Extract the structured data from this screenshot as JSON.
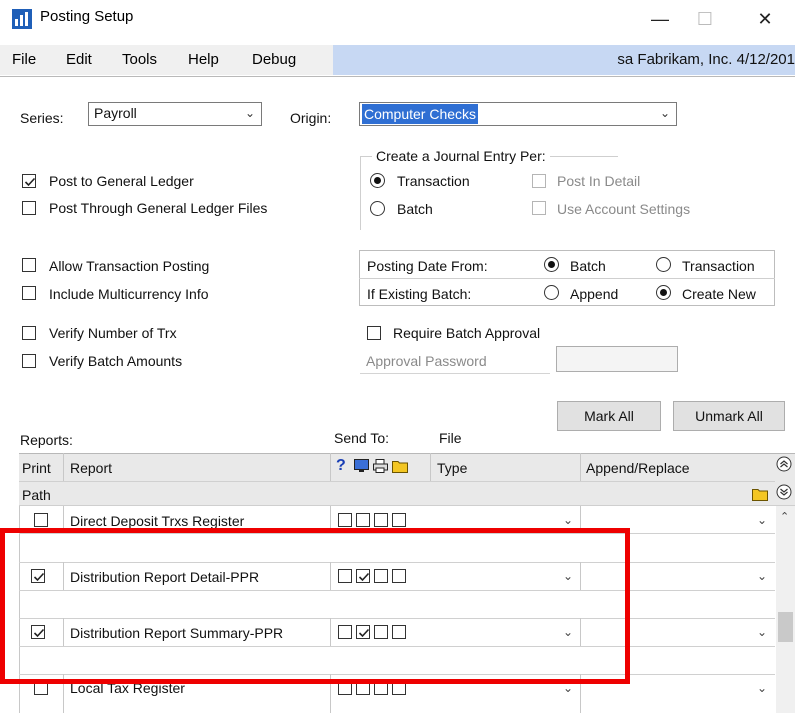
{
  "window": {
    "title": "Posting Setup",
    "minimize_glyph": "—",
    "maximize_glyph": "☐",
    "close_glyph": "✕",
    "app_icon": "chart-app-icon"
  },
  "menu": {
    "items": [
      "File",
      "Edit",
      "Tools",
      "Help",
      "Debug"
    ],
    "user_info": "sa  Fabrikam, Inc.  4/12/201"
  },
  "form": {
    "series_label": "Series:",
    "series_value": "Payroll",
    "origin_label": "Origin:",
    "origin_value": "Computer Checks",
    "post_to_gl": {
      "label": "Post to General Ledger",
      "checked": true
    },
    "post_through_gl_files": {
      "label": "Post Through General Ledger Files",
      "checked": false
    },
    "journal_entry": {
      "legend": "Create a Journal Entry Per:",
      "transaction_label": "Transaction",
      "batch_label": "Batch",
      "selected": "Transaction",
      "post_in_detail_label": "Post In Detail",
      "use_account_settings_label": "Use Account Settings"
    },
    "allow_transaction_posting": {
      "label": "Allow Transaction Posting",
      "checked": false
    },
    "include_multicurrency": {
      "label": "Include Multicurrency Info",
      "checked": false
    },
    "posting_date": {
      "label": "Posting Date From:",
      "batch_label": "Batch",
      "transaction_label": "Transaction",
      "selected": "Batch"
    },
    "existing_batch": {
      "label": "If Existing Batch:",
      "append_label": "Append",
      "create_new_label": "Create New",
      "selected": "Create New"
    },
    "verify_number_trx": {
      "label": "Verify Number of Trx",
      "checked": false
    },
    "verify_batch_amounts": {
      "label": "Verify Batch Amounts",
      "checked": false
    },
    "require_batch_approval": {
      "label": "Require Batch Approval",
      "checked": false
    },
    "approval_password_label": "Approval Password"
  },
  "buttons": {
    "mark_all": "Mark All",
    "unmark_all": "Unmark All"
  },
  "reports": {
    "reports_label": "Reports:",
    "send_to_label": "Send To:",
    "file_label": "File",
    "headers": {
      "print": "Print",
      "report": "Report",
      "help_glyph": "?",
      "type": "Type",
      "append_replace": "Append/Replace",
      "path": "Path"
    },
    "rows": [
      {
        "report": "Direct Deposit Trxs Register",
        "print": false,
        "screen": false,
        "printer": false,
        "file": false
      },
      {
        "report": "Distribution Report Detail-PPR",
        "print": true,
        "screen": false,
        "printer": true,
        "file": false
      },
      {
        "report": "Distribution Report Summary-PPR",
        "print": true,
        "screen": false,
        "printer": true,
        "file": false
      },
      {
        "report": "Local Tax Register",
        "print": false,
        "screen": false,
        "printer": false,
        "file": false
      }
    ]
  },
  "colors": {
    "highlight_box": "#ee0000",
    "selection_blue": "#2f6fd3",
    "userbar_blue": "#c7d8f3"
  }
}
